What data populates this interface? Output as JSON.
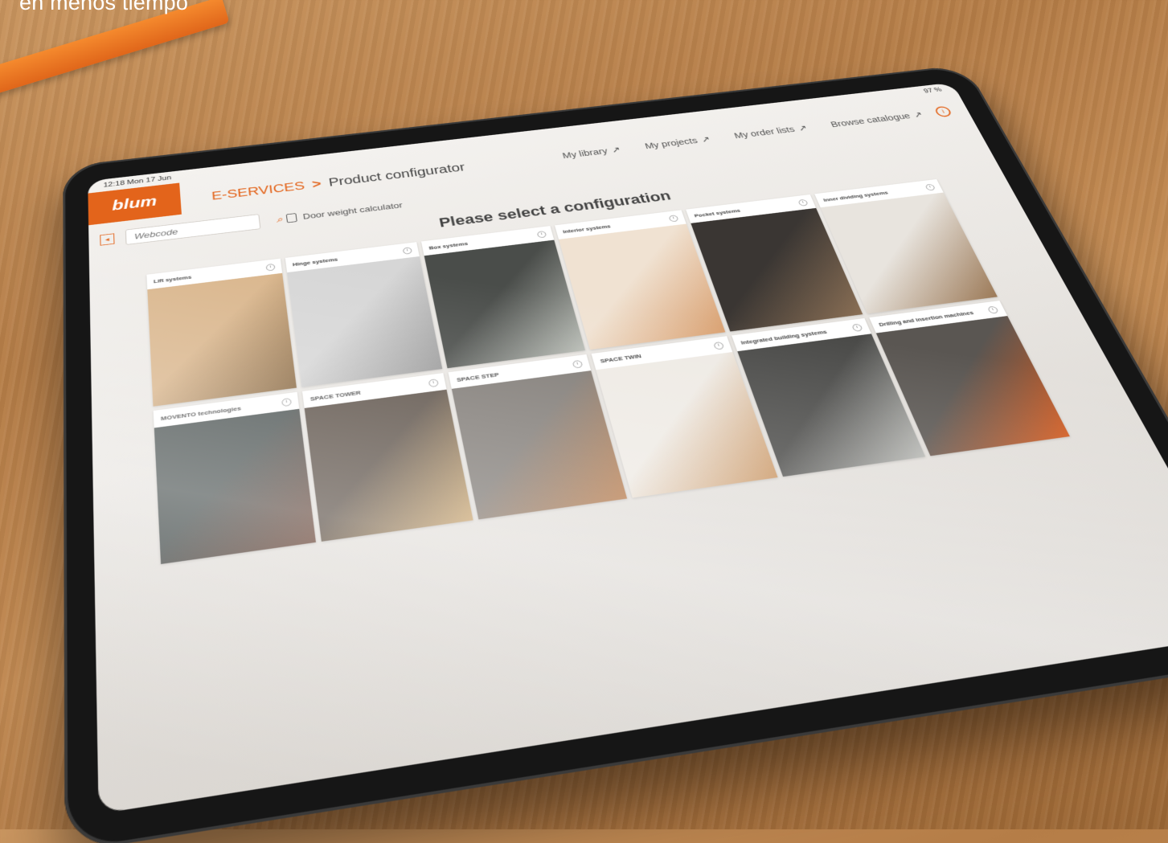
{
  "caption": "en menos tiempo",
  "status": {
    "time": "12:18",
    "date": "Mon 17 Jun",
    "battery": "97 %"
  },
  "header": {
    "logo": "blum",
    "breadcrumb_root": "E-SERVICES",
    "breadcrumb_sep": ">",
    "title": "Product configurator",
    "nav": [
      {
        "label": "My library",
        "arrow": "↗"
      },
      {
        "label": "My projects",
        "arrow": "↗"
      },
      {
        "label": "My order lists",
        "arrow": "↗"
      },
      {
        "label": "Browse catalogue",
        "arrow": "↗"
      }
    ]
  },
  "toolbar": {
    "search_placeholder": "Webcode",
    "calculator_label": "Door weight calculator"
  },
  "main": {
    "heading": "Please select a configuration",
    "cards": [
      {
        "label": "Lift systems",
        "colors": [
          "#d9b58b",
          "#8a6a44"
        ]
      },
      {
        "label": "Hinge systems",
        "colors": [
          "#d6d6d6",
          "#9a9a9a"
        ]
      },
      {
        "label": "Box systems",
        "colors": [
          "#4a4d4a",
          "#b9bdb6"
        ]
      },
      {
        "label": "Interior systems",
        "colors": [
          "#f0e2d2",
          "#d9a070"
        ]
      },
      {
        "label": "Pocket systems",
        "colors": [
          "#3a3633",
          "#8a6f55"
        ]
      },
      {
        "label": "Inner dividing systems",
        "colors": [
          "#e8e4de",
          "#9c7a58"
        ]
      },
      {
        "label": "MOVENTO technologies",
        "colors": [
          "#4b5352",
          "#6e4a3c"
        ]
      },
      {
        "label": "SPACE TOWER",
        "colors": [
          "#5b5047",
          "#c9a46e"
        ]
      },
      {
        "label": "SPACE STEP",
        "colors": [
          "#7e7974",
          "#b77a4a"
        ]
      },
      {
        "label": "SPACE TWIN",
        "colors": [
          "#eeeae4",
          "#c99562"
        ]
      },
      {
        "label": "Integrated building systems",
        "colors": [
          "#4a4a48",
          "#b7b8b4"
        ]
      },
      {
        "label": "Drilling and insertion machines",
        "colors": [
          "#5a5652",
          "#d35a1e"
        ]
      }
    ]
  },
  "colors": {
    "accent": "#e3641b"
  }
}
